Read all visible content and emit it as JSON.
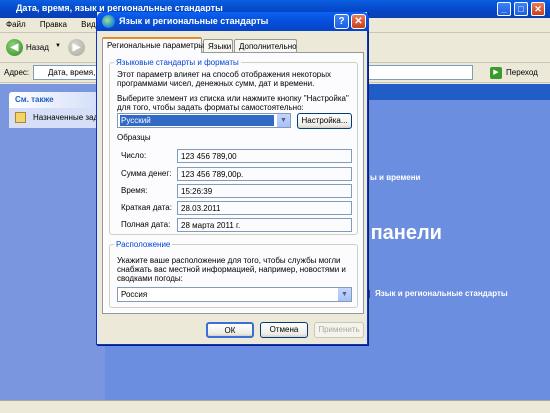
{
  "explorer": {
    "title": "Дата, время, язык и региональные стандарты",
    "menu": [
      "Файл",
      "Правка",
      "Вид"
    ],
    "back_label": "Назад",
    "address_label": "Адрес:",
    "address_value": "Дата, время, язык и региональные стандарты",
    "go_label": "Переход",
    "see_also": "См. также",
    "scheduled": "Назначенные задания",
    "right_mid": "ы и времени",
    "right_big": "к панели",
    "right_link": "Язык и региональные стандарты"
  },
  "dialog": {
    "title": "Язык и региональные стандарты",
    "help_btn": "?",
    "close_btn": "✕",
    "tabs": [
      "Региональные параметры",
      "Языки",
      "Дополнительно"
    ],
    "group1_title": "Языковые стандарты и форматы",
    "desc1": [
      "Этот параметр влияет на способ отображения некоторых",
      "программами чисел, денежных сумм, дат и времени."
    ],
    "desc2": [
      "Выберите элемент из списка или нажмите кнопку \"Настройка\"",
      "для того, чтобы задать форматы самостоятельно:"
    ],
    "locale_value": "Русский",
    "customize_btn": "Настройка...",
    "samples_label": "Образцы",
    "samples": [
      {
        "label": "Число:",
        "value": "123 456 789,00"
      },
      {
        "label": "Сумма денег:",
        "value": "123 456 789,00р."
      },
      {
        "label": "Время:",
        "value": "15:26:39"
      },
      {
        "label": "Краткая дата:",
        "value": "28.03.2011"
      },
      {
        "label": "Полная дата:",
        "value": "28 марта 2011 г."
      }
    ],
    "group2_title": "Расположение",
    "desc3": [
      "Укажите ваше расположение для того, чтобы службы могли",
      "снабжать вас местной информацией, например, новостями и",
      "сводками погоды:"
    ],
    "location_value": "Россия",
    "ok_btn": "ОК",
    "cancel_btn": "Отмена",
    "apply_btn": "Применить"
  }
}
